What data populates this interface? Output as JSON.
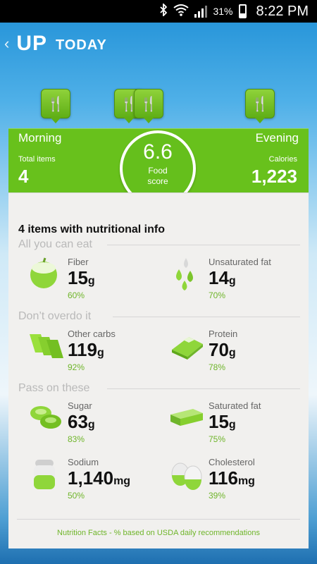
{
  "status_bar": {
    "battery": "31%",
    "time": "8:22 PM",
    "icons": [
      "bluetooth-icon",
      "wifi-icon",
      "signal-icon",
      "battery-icon"
    ]
  },
  "header": {
    "back": "‹",
    "brand": "UP",
    "subtitle": "TODAY"
  },
  "meals": [
    {
      "icon": "fork-knife-icon",
      "glyph": "🍴"
    },
    {
      "icon": "fork-knife-icon",
      "glyph": "🍴"
    },
    {
      "icon": "fork-knife-icon",
      "glyph": "🍴"
    },
    {
      "icon": "fork-knife-icon",
      "glyph": "🍴"
    }
  ],
  "summary": {
    "morning_label": "Morning",
    "evening_label": "Evening",
    "total_items_label": "Total items",
    "total_items_value": "4",
    "calories_label": "Calories",
    "calories_value": "1,223",
    "score_value": "6.6",
    "score_label": "Food score"
  },
  "card": {
    "title": "4 items with nutritional info",
    "sections": [
      {
        "title": "All you can eat",
        "items": [
          {
            "name": "Fiber",
            "value": "15",
            "unit": "g",
            "pct": "60%",
            "icon": "apple-icon"
          },
          {
            "name": "Unsaturated fat",
            "value": "14",
            "unit": "g",
            "pct": "70%",
            "icon": "oil-drops-icon"
          }
        ]
      },
      {
        "title": "Don’t overdo it",
        "items": [
          {
            "name": "Other carbs",
            "value": "119",
            "unit": "g",
            "pct": "92%",
            "icon": "bread-slices-icon"
          },
          {
            "name": "Protein",
            "value": "70",
            "unit": "g",
            "pct": "78%",
            "icon": "meat-icon"
          }
        ]
      },
      {
        "title": "Pass on these",
        "items": [
          {
            "name": "Sugar",
            "value": "63",
            "unit": "g",
            "pct": "83%",
            "icon": "candy-icon"
          },
          {
            "name": "Saturated fat",
            "value": "15",
            "unit": "g",
            "pct": "75%",
            "icon": "butter-icon"
          },
          {
            "name": "Sodium",
            "value": "1,140",
            "unit": "mg",
            "pct": "50%",
            "icon": "salt-shaker-icon"
          },
          {
            "name": "Cholesterol",
            "value": "116",
            "unit": "mg",
            "pct": "39%",
            "icon": "eggs-icon"
          }
        ]
      }
    ],
    "footer": "Nutrition Facts - % based on USDA daily recommendations"
  },
  "colors": {
    "accent_green": "#68c11c",
    "pct_green": "#6fb52a",
    "card_bg": "#f1f0ee"
  }
}
